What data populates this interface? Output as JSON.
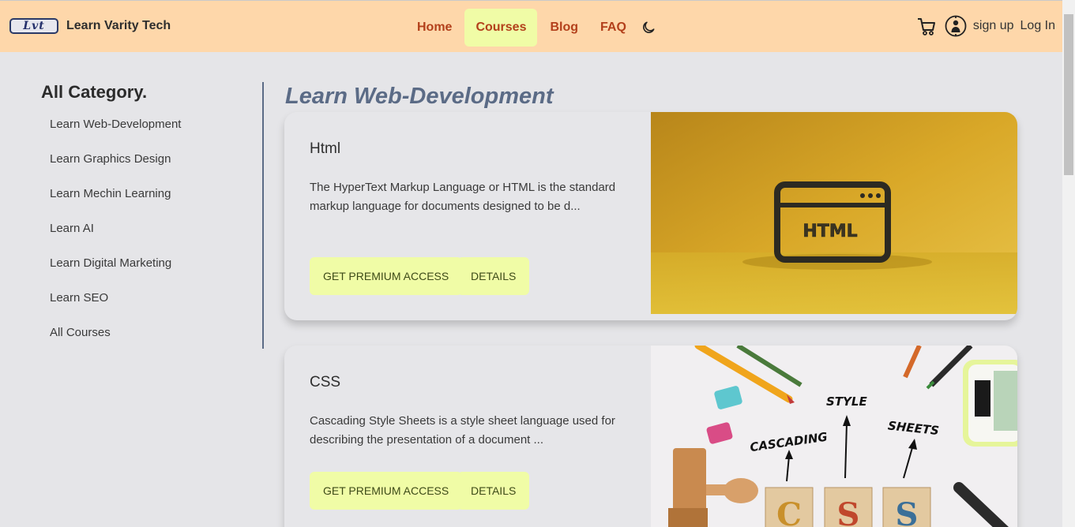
{
  "header": {
    "logo_text": "Lvt",
    "brand_name": "Learn Varity Tech",
    "nav": [
      "Home",
      "Courses",
      "Blog",
      "FAQ"
    ],
    "active_nav": "Courses",
    "signup_label": "sign up",
    "login_label": "Log In"
  },
  "sidebar": {
    "title": "All Category.",
    "items": [
      "Learn Web-Development",
      "Learn Graphics Design",
      "Learn Mechin Learning",
      "Learn AI",
      "Learn Digital Marketing",
      "Learn SEO",
      "All Courses"
    ]
  },
  "main": {
    "title": "Learn Web-Development",
    "courses": [
      {
        "title": "Html",
        "description": "The HyperText Markup Language or HTML is the standard markup language for documents designed to be d...",
        "premium_label": "GET PREMIUM ACCESS",
        "details_label": "DETAILS",
        "image_text": "HTML"
      },
      {
        "title": "CSS",
        "description": "Cascading Style Sheets is a style sheet language used for describing the presentation of a document ...",
        "premium_label": "GET PREMIUM ACCESS",
        "details_label": "DETAILS",
        "image_words": [
          "CASCADING",
          "STYLE",
          "SHEETS"
        ],
        "image_blocks": [
          "C",
          "S",
          "S"
        ]
      }
    ]
  },
  "colors": {
    "header_bg": "#fed7aa",
    "nav_text": "#b3401b",
    "accent_button": "#f0fca6",
    "title_blue": "#5b6b86"
  },
  "icons": [
    "moon-icon",
    "cart-icon",
    "user-icon"
  ]
}
